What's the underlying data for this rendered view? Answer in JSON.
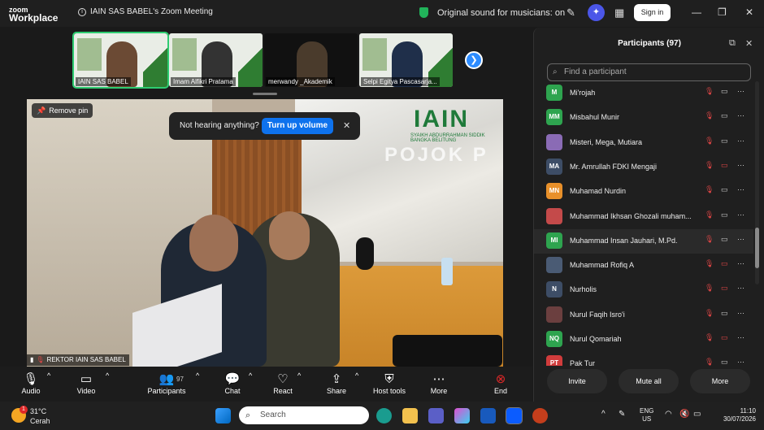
{
  "titlebar": {
    "logo_line1": "zoom",
    "logo_line2": "Workplace",
    "meeting_title": "IAIN SAS BABEL's Zoom Meeting",
    "original_sound": "Original sound for musicians: on",
    "signin_label": "Sign in"
  },
  "thumbnails": [
    {
      "name": "IAIN SAS BABEL"
    },
    {
      "name": "Imam Alfikri Pratama"
    },
    {
      "name": "merwandy _Akademik"
    },
    {
      "name": "Selpi Egitya Pascasarja..."
    }
  ],
  "video": {
    "remove_pin": "Remove pin",
    "banner_title": "IAIN",
    "banner_sub": "SYAIKH ABDURRAHMAN SIDDIK BANGKA BELITUNG",
    "banner_pojok": "POJOK P",
    "not_hearing": "Not hearing anything?",
    "turn_up": "Turn up volume",
    "speaker_name": "REKTOR IAIN SAS BABEL"
  },
  "toolbar": {
    "audio": "Audio",
    "video": "Video",
    "participants": "Participants",
    "participants_count": "97",
    "chat": "Chat",
    "react": "React",
    "share": "Share",
    "host_tools": "Host tools",
    "more": "More",
    "end": "End"
  },
  "panel": {
    "title": "Participants (97)",
    "search_placeholder": "Find a participant",
    "participants": [
      {
        "initials": "M",
        "name": "Mi'rojah",
        "color": "#2ea44f",
        "mic_muted": true,
        "cam_off": false
      },
      {
        "initials": "MM",
        "name": "Misbahul Munir",
        "color": "#2ea44f",
        "mic_muted": true,
        "cam_off": false
      },
      {
        "initials": "",
        "name": "Misteri, Mega, Mutiara",
        "color": "#8a6bb5",
        "mic_muted": true,
        "cam_off": false
      },
      {
        "initials": "MA",
        "name": "Mr. Amrullah FDKI Mengaji",
        "color": "#3d4d66",
        "mic_muted": true,
        "cam_off": true
      },
      {
        "initials": "MN",
        "name": "Muhamad Nurdin",
        "color": "#e8902a",
        "mic_muted": true,
        "cam_off": false
      },
      {
        "initials": "",
        "name": "Muhammad Ikhsan Ghozali muham...",
        "color": "#c44a4a",
        "mic_muted": true,
        "cam_off": false
      },
      {
        "initials": "MI",
        "name": "Muhammad Insan Jauhari, M.Pd.",
        "color": "#2ea44f",
        "mic_muted": true,
        "cam_off": false
      },
      {
        "initials": "",
        "name": "Muhammad Rofiq A",
        "color": "#4a5b74",
        "mic_muted": true,
        "cam_off": true
      },
      {
        "initials": "N",
        "name": "Nurholis",
        "color": "#3d4d66",
        "mic_muted": true,
        "cam_off": true
      },
      {
        "initials": "",
        "name": "Nurul Faqih Isro'i",
        "color": "#6b3f3f",
        "mic_muted": true,
        "cam_off": false
      },
      {
        "initials": "NQ",
        "name": "Nurul Qomariah",
        "color": "#2ea44f",
        "mic_muted": true,
        "cam_off": true
      },
      {
        "initials": "PT",
        "name": "Pak Tur",
        "color": "#d13c3c",
        "mic_muted": true,
        "cam_off": false
      }
    ],
    "invite": "Invite",
    "mute_all": "Mute all",
    "more": "More"
  },
  "taskbar": {
    "temp": "31°C",
    "weather": "Cerah",
    "weather_badge": "1",
    "search": "Search",
    "lang1": "ENG",
    "lang2": "US",
    "time": "11:10",
    "date": "30/07/2026"
  }
}
